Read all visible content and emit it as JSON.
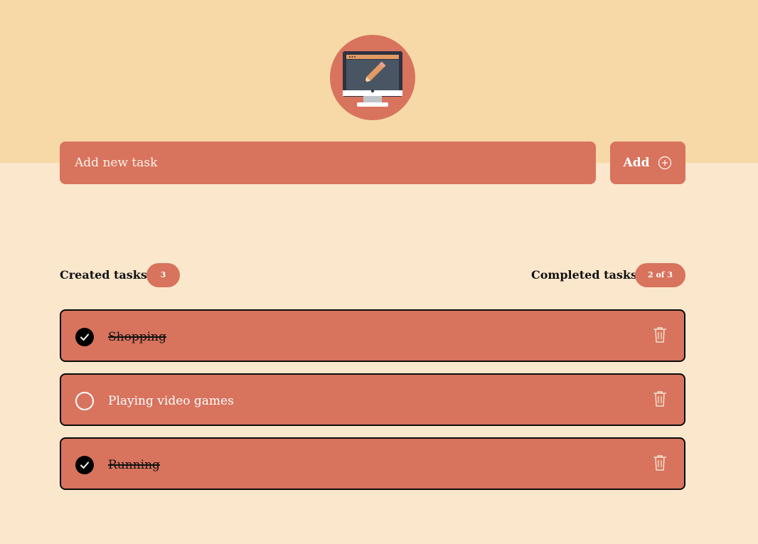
{
  "header": {
    "logo_icon": "computer-pencil-icon"
  },
  "new_task": {
    "placeholder": "Add new task",
    "value": ""
  },
  "add_button": {
    "label": "Add",
    "icon": "plus-circle-icon"
  },
  "counters": {
    "created_label": "Created tasks",
    "created_count": "3",
    "completed_label": "Completed tasks",
    "completed_count": "2 of 3"
  },
  "tasks": [
    {
      "title": "Shopping",
      "completed": true
    },
    {
      "title": "Playing video games",
      "completed": false
    },
    {
      "title": "Running",
      "completed": true
    }
  ],
  "colors": {
    "header_background": "#f6d9a6",
    "page_background": "#fae7cc",
    "accent": "#d8735e",
    "text_dark": "#111111",
    "text_light": "#ffffff"
  }
}
